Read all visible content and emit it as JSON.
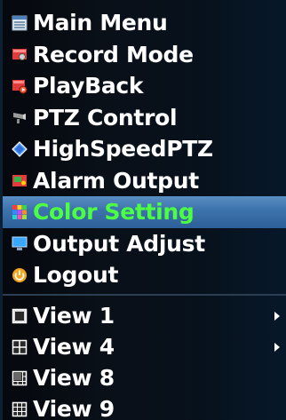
{
  "menu": {
    "main_items": [
      {
        "label": "Main Menu",
        "icon": "grid-icon"
      },
      {
        "label": "Record Mode",
        "icon": "camera-record-icon"
      },
      {
        "label": "PlayBack",
        "icon": "playback-icon"
      },
      {
        "label": "PTZ Control",
        "icon": "ptz-camera-icon"
      },
      {
        "label": "HighSpeedPTZ",
        "icon": "diamond-icon"
      },
      {
        "label": "Alarm Output",
        "icon": "alarm-icon"
      },
      {
        "label": "Color Setting",
        "icon": "color-palette-icon",
        "selected": true
      },
      {
        "label": "Output Adjust",
        "icon": "monitor-icon"
      },
      {
        "label": "Logout",
        "icon": "power-icon"
      }
    ],
    "view_items": [
      {
        "label": "View 1",
        "icon": "single-view-icon",
        "has_submenu": true
      },
      {
        "label": "View 4",
        "icon": "quad-view-icon",
        "has_submenu": true
      },
      {
        "label": "View 8",
        "icon": "eight-view-icon",
        "has_submenu": false
      },
      {
        "label": "View 9",
        "icon": "nine-view-icon",
        "has_submenu": false
      }
    ]
  },
  "colors": {
    "selected_text": "#4cff43",
    "selected_background": "#3e74ad",
    "text": "#ffffff",
    "background": "#07111c"
  }
}
